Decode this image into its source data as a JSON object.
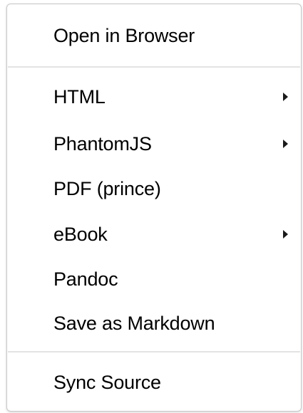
{
  "menu": {
    "items": [
      {
        "label": "Open in Browser",
        "submenu": false
      },
      {
        "label": "HTML",
        "submenu": true
      },
      {
        "label": "PhantomJS",
        "submenu": true
      },
      {
        "label": "PDF (prince)",
        "submenu": false
      },
      {
        "label": "eBook",
        "submenu": true
      },
      {
        "label": "Pandoc",
        "submenu": false
      },
      {
        "label": "Save as Markdown",
        "submenu": false
      },
      {
        "label": "Sync Source",
        "submenu": false
      }
    ],
    "icons": {
      "submenu_arrow": "chevron-right-icon"
    },
    "colors": {
      "background": "#ffffff",
      "text": "#000000",
      "separator": "#e3e3e3",
      "border": "#c9c9c9"
    }
  }
}
